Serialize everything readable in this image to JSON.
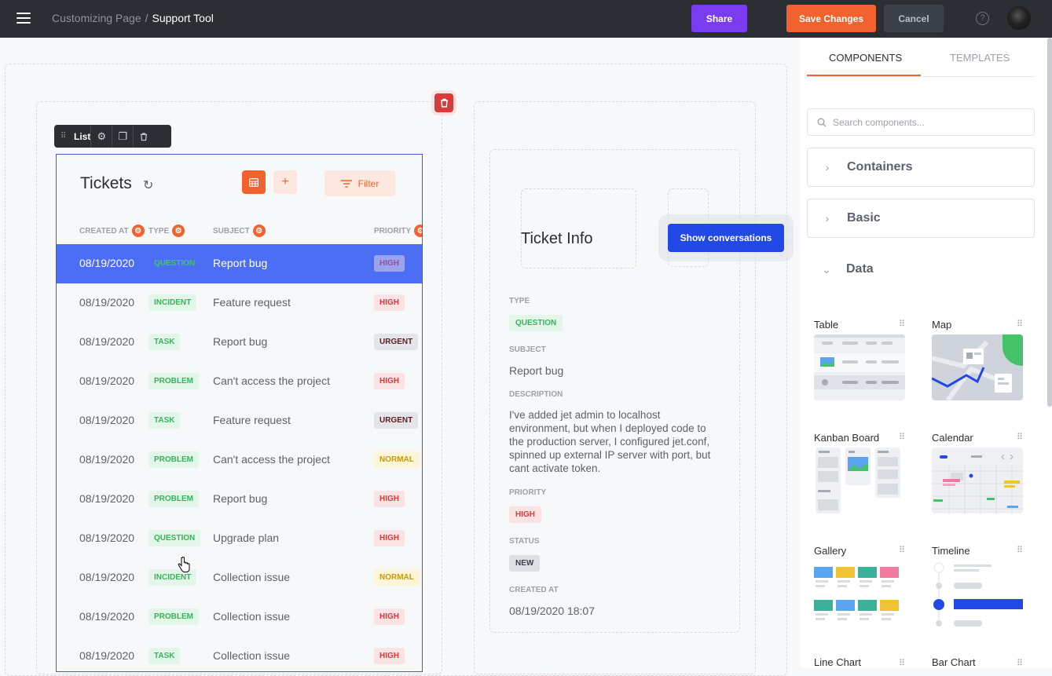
{
  "topbar": {
    "breadcrumb_parent": "Customizing Page",
    "breadcrumb_sep": "/",
    "breadcrumb_current": "Support Tool",
    "share_label": "Share",
    "save_label": "Save Changes",
    "cancel_label": "Cancel",
    "help_label": "?"
  },
  "list_toolbar": {
    "label": "List"
  },
  "tickets": {
    "title": "Tickets",
    "filter_label": "Filter",
    "columns": [
      "CREATED AT",
      "TYPE",
      "SUBJECT",
      "PRIORITY"
    ],
    "rows": [
      {
        "created": "08/19/2020",
        "type": "QUESTION",
        "subject": "Report bug",
        "priority": "HIGH"
      },
      {
        "created": "08/19/2020",
        "type": "INCIDENT",
        "subject": "Feature request",
        "priority": "HIGH"
      },
      {
        "created": "08/19/2020",
        "type": "TASK",
        "subject": "Report bug",
        "priority": "URGENT"
      },
      {
        "created": "08/19/2020",
        "type": "PROBLEM",
        "subject": "Can't access the project",
        "priority": "HIGH"
      },
      {
        "created": "08/19/2020",
        "type": "TASK",
        "subject": "Feature request",
        "priority": "URGENT"
      },
      {
        "created": "08/19/2020",
        "type": "PROBLEM",
        "subject": "Can't access the project",
        "priority": "NORMAL"
      },
      {
        "created": "08/19/2020",
        "type": "PROBLEM",
        "subject": "Report bug",
        "priority": "HIGH"
      },
      {
        "created": "08/19/2020",
        "type": "QUESTION",
        "subject": "Upgrade plan",
        "priority": "HIGH"
      },
      {
        "created": "08/19/2020",
        "type": "INCIDENT",
        "subject": "Collection issue",
        "priority": "NORMAL"
      },
      {
        "created": "08/19/2020",
        "type": "PROBLEM",
        "subject": "Collection issue",
        "priority": "HIGH"
      },
      {
        "created": "08/19/2020",
        "type": "TASK",
        "subject": "Collection issue",
        "priority": "HIGH"
      }
    ]
  },
  "ticket_info": {
    "title": "Ticket Info",
    "show_conversations_label": "Show conversations",
    "type_label": "TYPE",
    "type_value": "QUESTION",
    "subject_label": "SUBJECT",
    "subject_value": "Report bug",
    "description_label": "DESCRIPTION",
    "description_value": "I've added jet admin to localhost environment, but when I deployed code to the production server, I configured jet.conf, spinned up external IP server with port, but cant activate token.",
    "priority_label": "PRIORITY",
    "priority_value": "HIGH",
    "status_label": "STATUS",
    "status_value": "NEW",
    "created_label": "CREATED AT",
    "created_value": "08/19/2020 18:07"
  },
  "sidebar": {
    "tab_components": "COMPONENTS",
    "tab_templates": "TEMPLATES",
    "search_placeholder": "Search components...",
    "groups": [
      "Containers",
      "Basic",
      "Data"
    ],
    "components": [
      "Table",
      "Map",
      "Kanban Board",
      "Calendar",
      "Gallery",
      "Timeline",
      "Line Chart",
      "Bar Chart"
    ]
  },
  "colors": {
    "accent": "#f1622f",
    "primary": "#2248e6",
    "share": "#7a3cf1",
    "selected_row": "#4c6ef5"
  }
}
